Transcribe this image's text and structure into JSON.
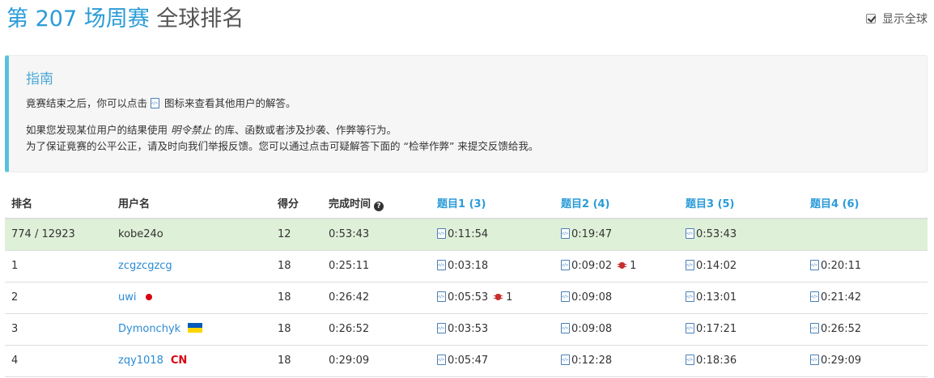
{
  "header": {
    "title_prefix": "第 207 场周赛",
    "title_suffix": "全球排名",
    "global_toggle_label": "显示全球",
    "global_toggle_checked": true
  },
  "guide": {
    "heading": "指南",
    "line1_before": "竟赛结束之后，你可以点击",
    "line1_after": "图标来查看其他用户的解答。",
    "line2_before": "如果您发现某位用户的结果使用",
    "line2_em": "明令禁止",
    "line2_after": "的库、函数或者涉及抄袭、作弊等行为。",
    "line3": "为了保证竟赛的公平公正，请及时向我们举报反馈。您可以通过点击可疑解答下面的 “检举作弊” 来提交反馈给我。"
  },
  "table": {
    "headers": {
      "rank": "排名",
      "username": "用户名",
      "score": "得分",
      "finish_time": "完成时间",
      "q1": "题目1 (3)",
      "q2": "题目2 (4)",
      "q3": "题目3 (5)",
      "q4": "题目4 (6)"
    },
    "my_row": {
      "rank": "774 / 12923",
      "username": "kobe24o",
      "score": "12",
      "finish_time": "0:53:43",
      "q1": "0:11:54",
      "q2": "0:19:47",
      "q3": "0:53:43"
    },
    "rows": [
      {
        "rank": "1",
        "username": "zcgzcgzcg",
        "score": "18",
        "finish_time": "0:25:11",
        "q1": "0:03:18",
        "q2": "0:09:02",
        "q2_bugs": "1",
        "q3": "0:14:02",
        "q4": "0:20:11"
      },
      {
        "rank": "2",
        "username": "uwi",
        "score": "18",
        "finish_time": "0:26:42",
        "q1": "0:05:53",
        "q1_bugs": "1",
        "q2": "0:09:08",
        "q3": "0:13:01",
        "q4": "0:21:42"
      },
      {
        "rank": "3",
        "username": "Dymonchyk",
        "score": "18",
        "finish_time": "0:26:52",
        "q1": "0:03:53",
        "q2": "0:09:08",
        "q3": "0:17:21",
        "q4": "0:26:52"
      },
      {
        "rank": "4",
        "username": "zqy1018",
        "region": "CN",
        "score": "18",
        "finish_time": "0:29:09",
        "q1": "0:05:47",
        "q2": "0:12:28",
        "q3": "0:18:36",
        "q4": "0:29:09"
      }
    ]
  },
  "colors": {
    "accent_blue": "#2a9bd8",
    "my_row_bg": "#dff0d8",
    "guide_border": "#5bc0de",
    "red": "#d9000f"
  }
}
